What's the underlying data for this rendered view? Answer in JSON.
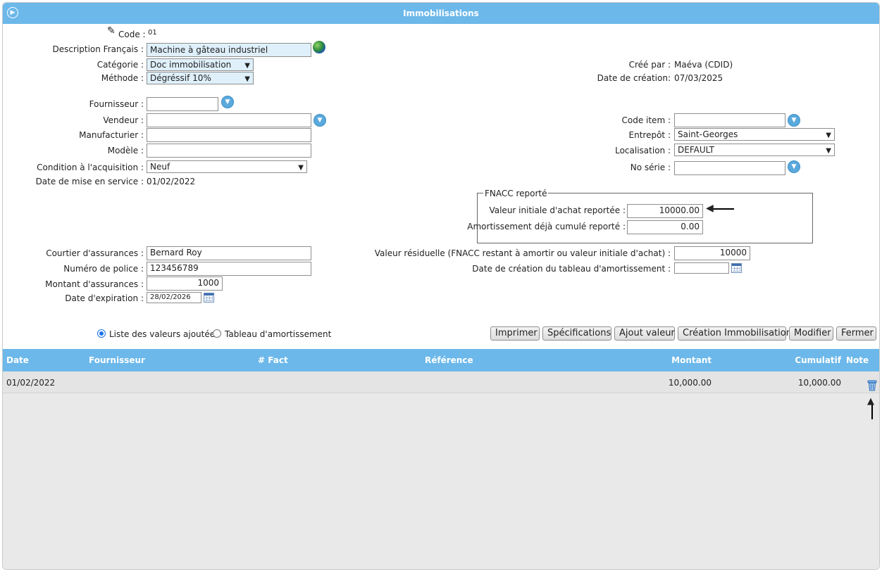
{
  "window": {
    "title": "Immobilisations"
  },
  "general": {
    "code_label": "Code :",
    "code_value": "01",
    "description_label": "Description Français :",
    "description_value": "Machine à gâteau industriel",
    "category_label": "Catégorie :",
    "category_value": "Doc immobilisation",
    "method_label": "Méthode :",
    "method_value": "Dégréssif 10%",
    "created_by_label": "Créé par :",
    "created_by_value": "Maéva (CDID)",
    "creation_date_label": "Date de création:",
    "creation_date_value": "07/03/2025"
  },
  "supplier": {
    "fournisseur_label": "Fournisseur :",
    "fournisseur_value": "",
    "vendeur_label": "Vendeur :",
    "vendeur_value": "",
    "manufacturier_label": "Manufacturier :",
    "manufacturier_value": "",
    "modele_label": "Modèle :",
    "modele_value": "",
    "condition_label": "Condition à l'acquisition :",
    "condition_value": "Neuf",
    "service_date_label": "Date de mise en service :",
    "service_date_value": "01/02/2022"
  },
  "item": {
    "code_item_label": "Code item :",
    "code_item_value": "",
    "entrepot_label": "Entrepôt :",
    "entrepot_value": "Saint-Georges",
    "localisation_label": "Localisation :",
    "localisation_value": "DEFAULT",
    "serial_label": "No série :",
    "serial_value": ""
  },
  "fnacc": {
    "legend": "FNACC reporté",
    "initial_value_label": "Valeur initiale d'achat reportée :",
    "initial_value": "10000.00",
    "cumulated_label": "Amortissement déjà cumulé reporté :",
    "cumulated_value": "0.00"
  },
  "residual": {
    "residual_label": "Valeur résiduelle (FNACC restant à amortir ou valeur initiale d'achat) :",
    "residual_value": "10000",
    "table_date_label": "Date de création du tableau d'amortissement :",
    "table_date_value": ""
  },
  "insurance": {
    "broker_label": "Courtier d'assurances :",
    "broker_value": "Bernard Roy",
    "policy_label": "Numéro de police :",
    "policy_value": "123456789",
    "amount_label": "Montant d'assurances :",
    "amount_value": "1000",
    "expiration_label": "Date d'expiration :",
    "expiration_value": "28/02/2026"
  },
  "view_options": {
    "added_values_label": "Liste des valeurs ajoutées",
    "amortization_label": "Tableau d'amortissement",
    "selected": "Liste des valeurs ajoutées"
  },
  "toolbar": {
    "print": "Imprimer",
    "specs": "Spécifications",
    "add_value": "Ajout valeur",
    "create": "Création Immobilisation",
    "modify": "Modifier",
    "close": "Fermer"
  },
  "table": {
    "headers": {
      "date": "Date",
      "supplier": "Fournisseur",
      "invoice": "# Fact",
      "reference": "Référence",
      "amount": "Montant",
      "cumulative": "Cumulatif",
      "note": "Note"
    },
    "rows": [
      {
        "date": "01/02/2022",
        "supplier": "",
        "invoice": "",
        "reference": "",
        "amount": "10,000.00",
        "cumulative": "10,000.00"
      }
    ]
  },
  "icons": {
    "titlebar": "collapse-icon",
    "code": "edit-pencil-icon",
    "description": "globe-icon",
    "lookup": "chevron-down-circle-icon",
    "calendar": "calendar-icon",
    "delete": "trash-icon"
  },
  "colors": {
    "header_blue": "#6cb8ea",
    "field_blue": "#dff0fb",
    "row_gray": "#e4e4e4"
  }
}
